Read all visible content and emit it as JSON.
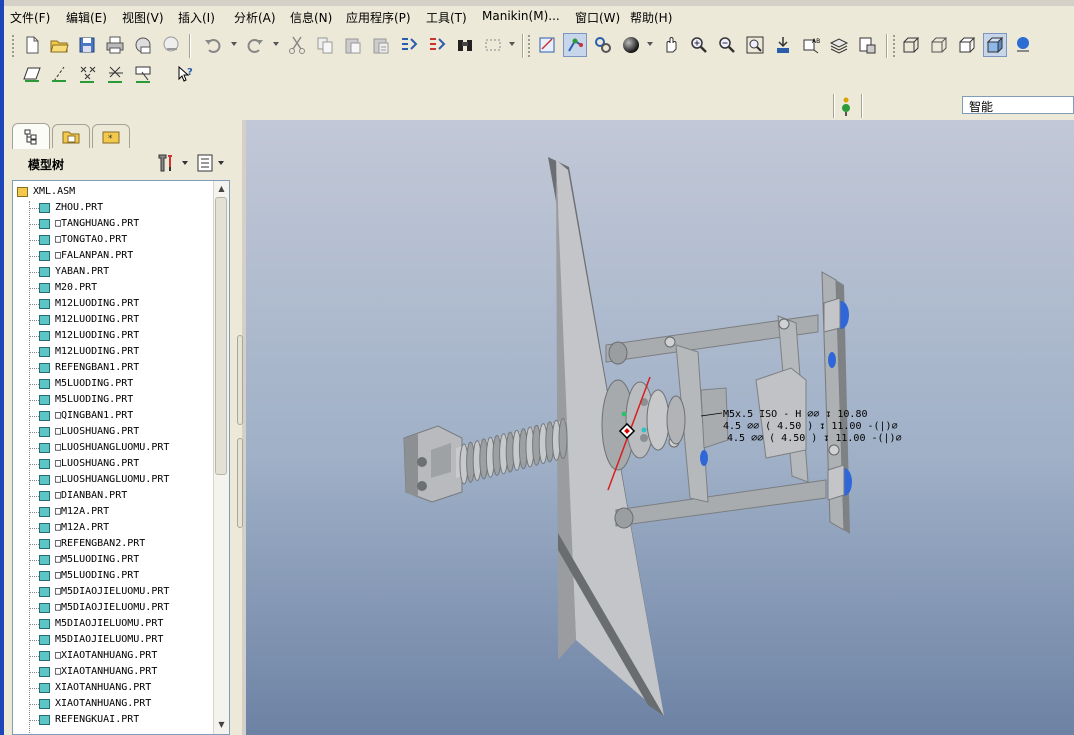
{
  "menu": [
    "文件(F)",
    "编辑(E)",
    "视图(V)",
    "插入(I)",
    "分析(A)",
    "信息(N)",
    "应用程序(P)",
    "工具(T)",
    "Manikin(M)...",
    "窗口(W)",
    "帮助(H)"
  ],
  "toolbar": {
    "row1": [
      "new-file-icon",
      "open-folder-icon",
      "save-icon",
      "print-icon",
      "email-icon",
      "link-icon",
      "undo-icon",
      "redo-icon",
      "cut-icon",
      "copy-icon",
      "paste-icon",
      "paste-special-icon",
      "regenerate-icon",
      "regen-manager-icon",
      "find-icon",
      "select-box-icon",
      "datum-display-icon",
      "spin-center-icon",
      "view-manager-icon",
      "appearance-icon",
      "pan-icon",
      "zoom-in-icon",
      "zoom-out-icon",
      "refit-icon",
      "reorient-icon",
      "saved-views-icon",
      "layers-icon",
      "setup-icon",
      "wireframe-icon",
      "hidden-line-icon",
      "no-hidden-icon",
      "shading-icon",
      "model-player-icon"
    ],
    "row2": [
      "datum-plane-icon",
      "datum-axis-icon",
      "datum-point-icon",
      "coord-sys-icon",
      "datum-curve-icon",
      "context-help-icon"
    ],
    "filter_label": "智能",
    "status_color": "#2e9b3a"
  },
  "panel": {
    "tabs": [
      "model-tree-tab",
      "folder-browser-tab",
      "favorites-tab"
    ],
    "title": "模型树",
    "tree": [
      "XML.ASM",
      "ZHOU.PRT",
      "□TANGHUANG.PRT",
      "□TONGTAO.PRT",
      "□FALANPAN.PRT",
      "YABAN.PRT",
      "M20.PRT",
      "M12LUODING.PRT",
      "M12LUODING.PRT",
      "M12LUODING.PRT",
      "M12LUODING.PRT",
      "REFENGBAN1.PRT",
      "M5LUODING.PRT",
      "M5LUODING.PRT",
      "□QINGBAN1.PRT",
      "□LUOSHUANG.PRT",
      "□LUOSHUANGLUOMU.PRT",
      "□LUOSHUANG.PRT",
      "□LUOSHUANGLUOMU.PRT",
      "□DIANBAN.PRT",
      "□M12A.PRT",
      "□M12A.PRT",
      "□REFENGBAN2.PRT",
      "□M5LUODING.PRT",
      "□M5LUODING.PRT",
      "□M5DIAOJIELUOMU.PRT",
      "□M5DIAOJIELUOMU.PRT",
      "M5DIAOJIELUOMU.PRT",
      "M5DIAOJIELUOMU.PRT",
      "□XIAOTANHUANG.PRT",
      "□XIAOTANHUANG.PRT",
      "XIAOTANHUANG.PRT",
      "XIAOTANHUANG.PRT",
      "REFENGKUAI.PRT"
    ]
  },
  "viewport": {
    "annotation": [
      "M5x.5 ISO - H ⌀⌀ ↧ 10.80",
      "4.5 ⌀⌀ ( 4.50 ) ↧ 11.00  -(|)⌀",
      "4.5 ⌀⌀ ( 4.50 ) ↧ 11.00  -(|)⌀"
    ],
    "background_top": "#c2c8d7",
    "background_bottom": "#6d82a4"
  }
}
